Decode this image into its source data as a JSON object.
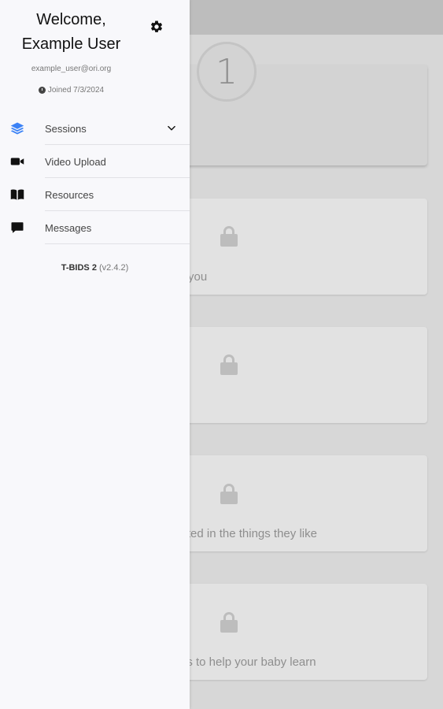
{
  "background": {
    "step_number": "1",
    "card2_text": "you",
    "card4_text": "ested in the things they like",
    "card5_text": "gs to help your baby learn"
  },
  "drawer": {
    "welcome_line1": "Welcome,",
    "welcome_line2": "Example User",
    "email": "example_user@ori.org",
    "joined": "Joined 7/3/2024",
    "nav": [
      {
        "label": "Sessions",
        "icon": "layers-icon",
        "color": "#3b82f6"
      },
      {
        "label": "Video Upload",
        "icon": "video-camera-icon",
        "color": "#111111"
      },
      {
        "label": "Resources",
        "icon": "book-icon",
        "color": "#111111"
      },
      {
        "label": "Messages",
        "icon": "chat-bubble-icon",
        "color": "#111111"
      }
    ],
    "app_name": "T-BIDS 2",
    "app_version": "(v2.4.2)"
  },
  "colors": {
    "accent": "#3b82f6",
    "drawer_bg": "#f8f8fb",
    "overlay": "#d7d7d7"
  }
}
